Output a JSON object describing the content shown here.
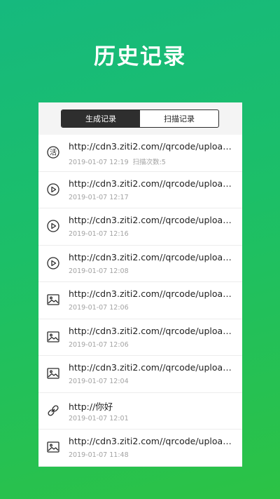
{
  "header": {
    "title": "历史记录"
  },
  "tabs": [
    {
      "label": "生成记录",
      "active": true
    },
    {
      "label": "扫描记录",
      "active": false
    }
  ],
  "records": [
    {
      "icon": "text-icon",
      "glyph": "活",
      "title": "http://cdn3.ziti2.com//qrcode/uploade...",
      "time": "2019-01-07 12:19",
      "count_label": "扫描次数:5"
    },
    {
      "icon": "video-icon",
      "title": "http://cdn3.ziti2.com//qrcode/uploade...",
      "time": "2019-01-07 12:17",
      "count_label": ""
    },
    {
      "icon": "video-icon",
      "title": "http://cdn3.ziti2.com//qrcode/uploade...",
      "time": "2019-01-07 12:16",
      "count_label": ""
    },
    {
      "icon": "video-icon",
      "title": "http://cdn3.ziti2.com//qrcode/uploade...",
      "time": "2019-01-07 12:08",
      "count_label": ""
    },
    {
      "icon": "image-icon",
      "title": "http://cdn3.ziti2.com//qrcode/uploade...",
      "time": "2019-01-07 12:06",
      "count_label": ""
    },
    {
      "icon": "image-icon",
      "title": "http://cdn3.ziti2.com//qrcode/uploade...",
      "time": "2019-01-07 12:06",
      "count_label": ""
    },
    {
      "icon": "image-icon",
      "title": "http://cdn3.ziti2.com//qrcode/uploade...",
      "time": "2019-01-07 12:04",
      "count_label": ""
    },
    {
      "icon": "link-icon",
      "title": "http://你好",
      "time": "2019-01-07 12:01",
      "count_label": ""
    },
    {
      "icon": "image-icon",
      "title": "http://cdn3.ziti2.com//qrcode/uploade...",
      "time": "2019-01-07 11:48",
      "count_label": ""
    }
  ],
  "colors": {
    "gradient_top": "#16b97e",
    "gradient_bottom": "#2cc245",
    "tab_active_bg": "#2e2e2e"
  }
}
